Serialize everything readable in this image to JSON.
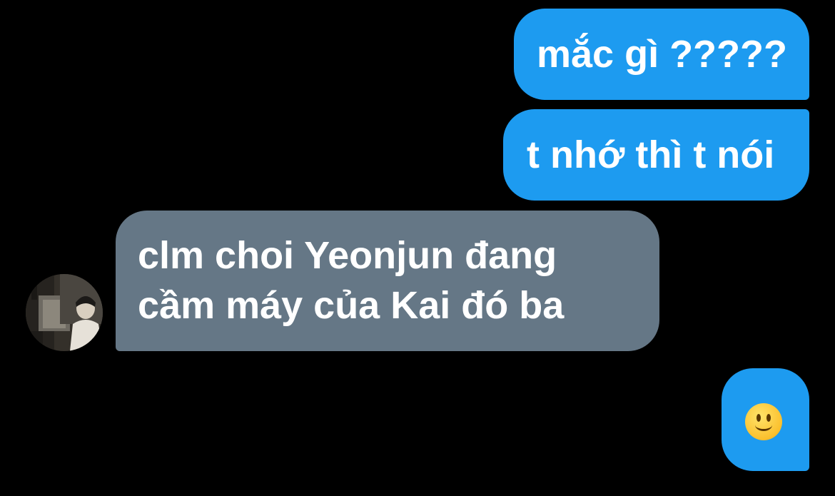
{
  "conversation": {
    "messages": [
      {
        "id": "m1",
        "direction": "sent",
        "text": "mắc gì ?????"
      },
      {
        "id": "m2",
        "direction": "sent",
        "text": "t nhớ thì t nói"
      },
      {
        "id": "m3",
        "direction": "received",
        "lines": [
          "clm choi Yeonjun đang",
          "cầm máy của Kai đó ba"
        ]
      },
      {
        "id": "m4",
        "direction": "sent",
        "emoji": "slightly-smiling-face"
      }
    ]
  },
  "colors": {
    "background": "#000000",
    "sent_bubble": "#1d9bf0",
    "received_bubble": "#657786",
    "text": "#ffffff"
  },
  "icons": {
    "avatar": "contact-profile-photo",
    "emoji": "slightly-smiling-face-emoji"
  }
}
